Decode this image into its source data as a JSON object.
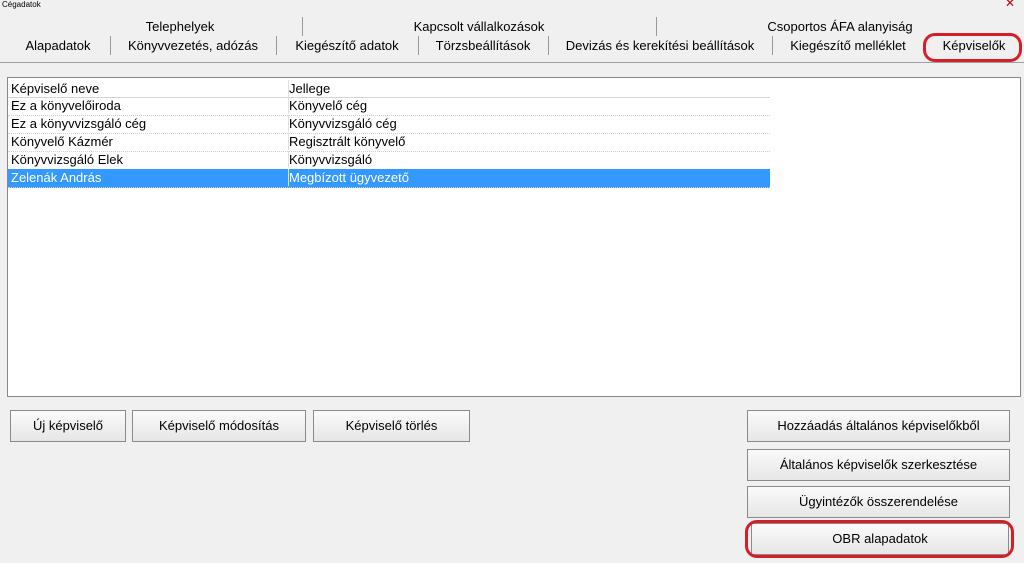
{
  "window": {
    "title": "Cégadatok",
    "close_glyph": "✕"
  },
  "tabs_top": [
    "Telephelyek",
    "Kapcsolt vállalkozások",
    "Csoportos ÁFA alanyiság"
  ],
  "tabs_bottom": [
    "Alapadatok",
    "Könyvvezetés, adózás",
    "Kiegészítő adatok",
    "Törzsbeállítások",
    "Devizás és kerekítési beállítások",
    "Kiegészítő melléklet",
    "Képviselők"
  ],
  "table": {
    "headers": [
      "Képviselő neve",
      "Jellege"
    ],
    "rows": [
      [
        "Ez a könyvelőiroda",
        "Könyvelő cég"
      ],
      [
        "Ez a könyvvizsgáló cég",
        "Könyvvizsgáló cég"
      ],
      [
        "Könyvelő Kázmér",
        "Regisztrált könyvelő"
      ],
      [
        "Könyvvizsgáló Elek",
        "Könyvvizsgáló"
      ],
      [
        "Zelenák András",
        "Megbízott ügyvezető"
      ]
    ],
    "selected_row": 4
  },
  "buttons": {
    "new": "Új képviselő",
    "modify": "Képviselő módosítás",
    "delete": "Képviselő törlés",
    "add_general": "Hozzáadás általános képviselőkből",
    "edit_general": "Általános képviselők szerkesztése",
    "assign_agents": "Ügyintézők összerendelése",
    "obr": "OBR alapadatok"
  },
  "colors": {
    "highlight": "#d41f28",
    "selection": "#3399ff"
  }
}
